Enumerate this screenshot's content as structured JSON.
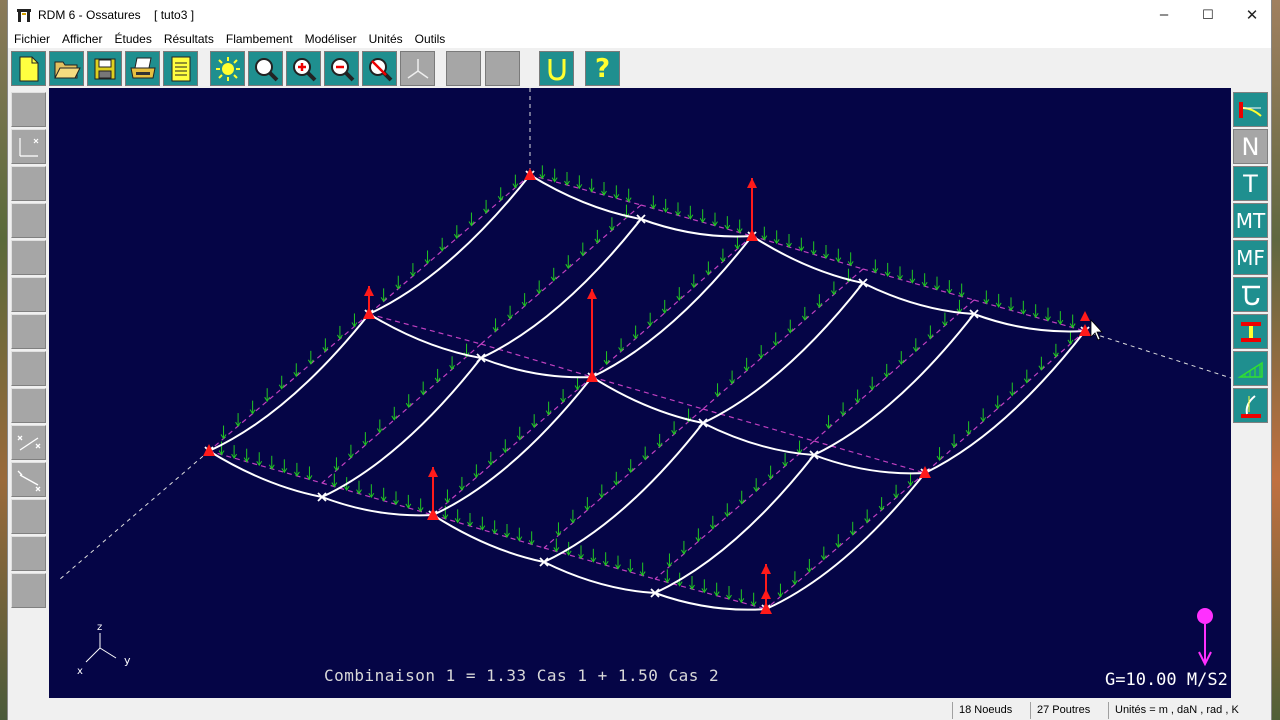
{
  "window": {
    "title": "RDM 6 - Ossatures",
    "subtitle": "[ tuto3 ]",
    "controls": {
      "minimize": "–",
      "maximize": "☐",
      "close": "✕"
    }
  },
  "menu": [
    "Fichier",
    "Afficher",
    "Études",
    "Résultats",
    "Flambement",
    "Modéliser",
    "Unités",
    "Outils"
  ],
  "toolbar": {
    "buttons": [
      "new-icon",
      "open-icon",
      "save-icon",
      "print-icon",
      "notes-icon",
      "sun-icon",
      "zoom-icon",
      "zoom-in-icon",
      "zoom-out-icon",
      "zoom-reset-icon",
      "axes-icon",
      "blank-1",
      "blank-2",
      "deformation-icon",
      "help-icon"
    ],
    "help_label": "?"
  },
  "right_panel": {
    "labels": [
      "",
      "N",
      "T",
      "MT",
      "MF",
      "",
      "",
      "",
      ""
    ]
  },
  "canvas": {
    "combination": "Combinaison 1 = 1.33 Cas 1 + 1.50 Cas 2",
    "gravity": "G=10.00 M/S2",
    "axes": {
      "z": "z",
      "x": "x",
      "y": "y"
    },
    "colors": {
      "background": "#050546",
      "structure": "#ffffff",
      "loads": "#22c822",
      "supports": "#ff1a1a",
      "initial": "#c040c0"
    }
  },
  "status": {
    "nodes": "18 Noeuds",
    "beams": "27 Poutres",
    "units": "Unités = m , daN , rad , K"
  }
}
